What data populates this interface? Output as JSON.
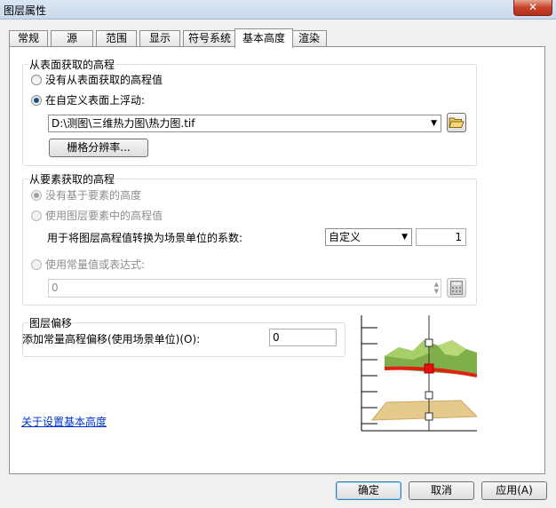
{
  "window": {
    "title": "图层属性",
    "close_glyph": "✕"
  },
  "tabs": [
    {
      "label": "常规"
    },
    {
      "label": "源"
    },
    {
      "label": "范围"
    },
    {
      "label": "显示"
    },
    {
      "label": "符号系统"
    },
    {
      "label": "基本高度"
    },
    {
      "label": "渲染"
    }
  ],
  "surface_group": {
    "title": "从表面获取的高程",
    "option_none": "没有从表面获取的高程值",
    "option_custom": "在自定义表面上浮动:",
    "selected": "custom",
    "surface_path": "D:\\测图\\三维热力图\\热力图.tif",
    "resolution_button": "栅格分辨率..."
  },
  "feature_group": {
    "title": "从要素获取的高程",
    "option_none": "没有基于要素的高度",
    "option_layer": "使用图层要素中的高程值",
    "factor_label": "用于将图层高程值转换为场景单位的系数:",
    "unit_select": "自定义",
    "factor_value": "1",
    "option_expression": "使用常量值或表达式:",
    "expression_value": "0",
    "selected": "none",
    "enabled": false
  },
  "offset_group": {
    "title": "图层偏移",
    "label": "添加常量高程偏移(使用场景单位)(O):",
    "value": "0"
  },
  "help_link": "关于设置基本高度",
  "buttons": {
    "ok": "确定",
    "cancel": "取消",
    "apply": "应用(A)"
  },
  "colors": {
    "accent": "#3c7fb1",
    "surface_line": "#e02010",
    "terrain": "#8fbf5a",
    "base_plane": "#e6c98c"
  },
  "icons": [
    "folder-open-icon",
    "calculator-icon",
    "close-icon",
    "chevron-down-icon"
  ]
}
